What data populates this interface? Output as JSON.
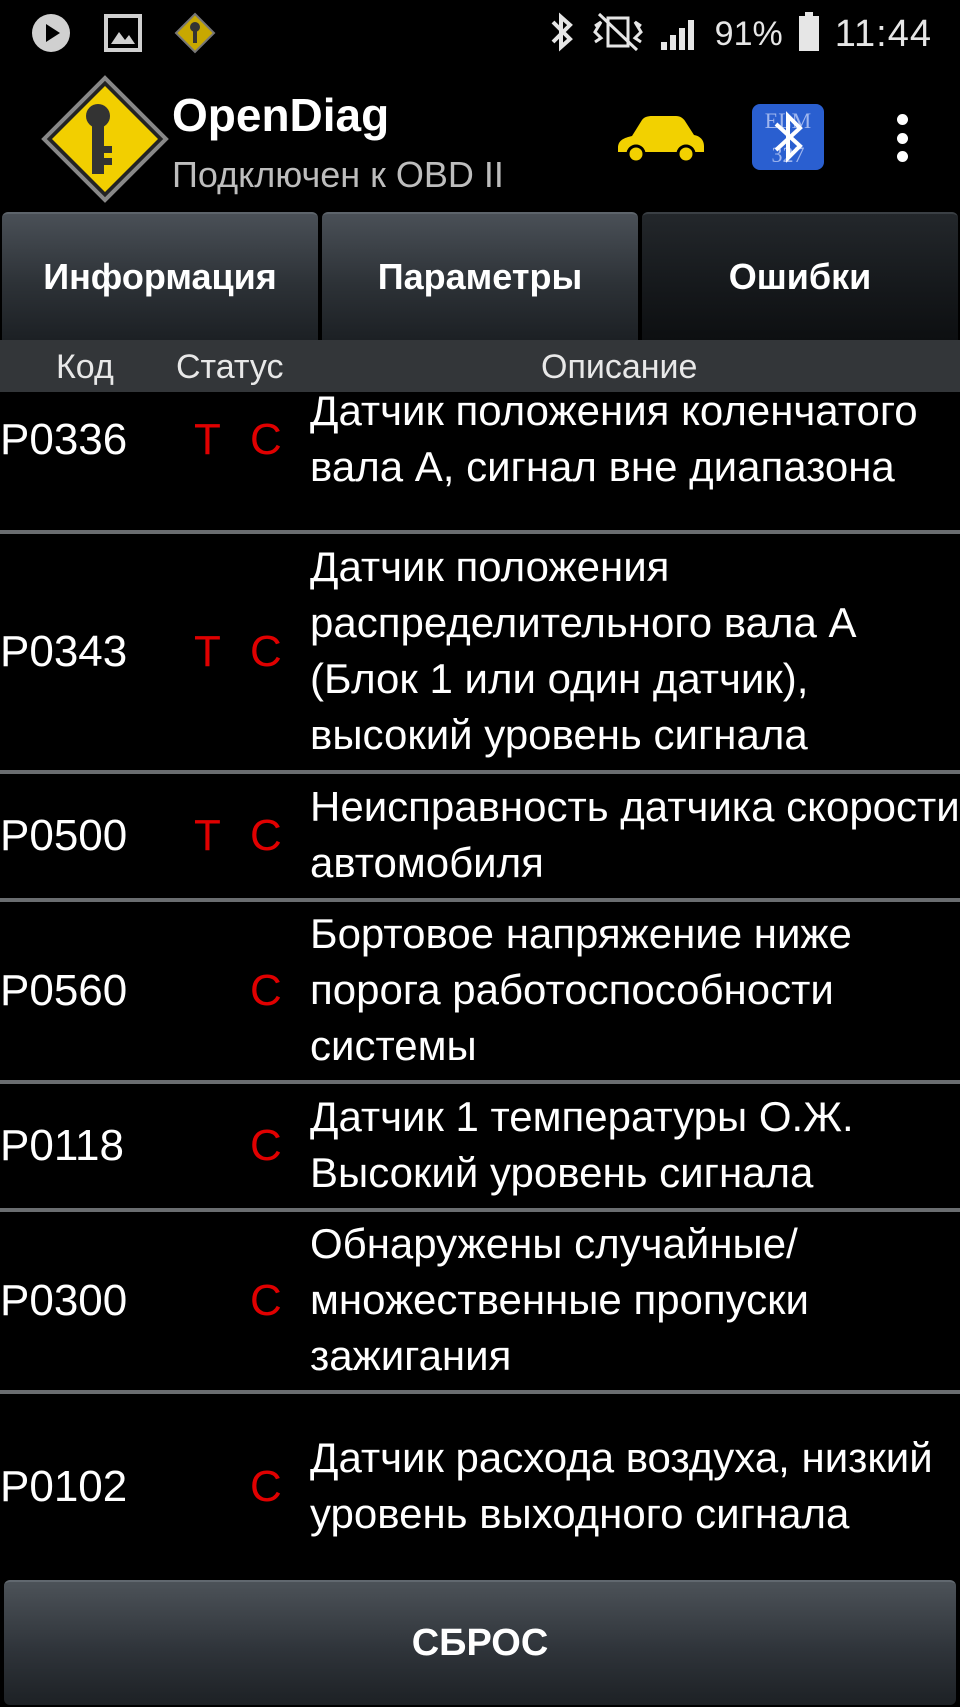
{
  "status_bar": {
    "icons_left": [
      "play-icon",
      "image-icon",
      "opendiag-notification-icon"
    ],
    "icons_right": [
      "bluetooth-icon",
      "vibrate-mute-icon",
      "signal-icon",
      "battery-icon"
    ],
    "battery": "91%",
    "time": "11:44"
  },
  "app": {
    "title": "OpenDiag",
    "subtitle": "Подключен к OBD II",
    "car_icon_color": "#f2d100",
    "bluetooth_badge_color": "#2a5fd0"
  },
  "tabs": [
    {
      "label": "Информация",
      "active": false
    },
    {
      "label": "Параметры",
      "active": false
    },
    {
      "label": "Ошибки",
      "active": true
    }
  ],
  "table": {
    "headers": {
      "code": "Код",
      "status": "Статус",
      "description": "Описание"
    },
    "rows": [
      {
        "code": "P0336",
        "t": "T",
        "c": "C",
        "description": "Датчик положения коленчатого вала А, сигнал вне диапазона"
      },
      {
        "code": "P0343",
        "t": "T",
        "c": "C",
        "description": "Датчик положения распределительного вала А (Блок 1 или один датчик), высокий уровень сигнала"
      },
      {
        "code": "P0500",
        "t": "T",
        "c": "C",
        "description": "Неисправность датчика скорости автомобиля"
      },
      {
        "code": "P0560",
        "t": "",
        "c": "C",
        "description": "Бортовое напряжение ниже порога работоспособности системы"
      },
      {
        "code": "P0118",
        "t": "",
        "c": "C",
        "description": "Датчик 1 температуры О.Ж. Высокий уровень сигнала"
      },
      {
        "code": "P0300",
        "t": "",
        "c": "C",
        "description": "Обнаружены случайные/ множественные пропуски зажигания"
      },
      {
        "code": "P0102",
        "t": "",
        "c": "C",
        "description": "Датчик расхода воздуха, низкий уровень выходного сигнала"
      }
    ]
  },
  "reset_button": "СБРОС",
  "colors": {
    "status_red": "#e00000",
    "header_bg": "#333639"
  }
}
